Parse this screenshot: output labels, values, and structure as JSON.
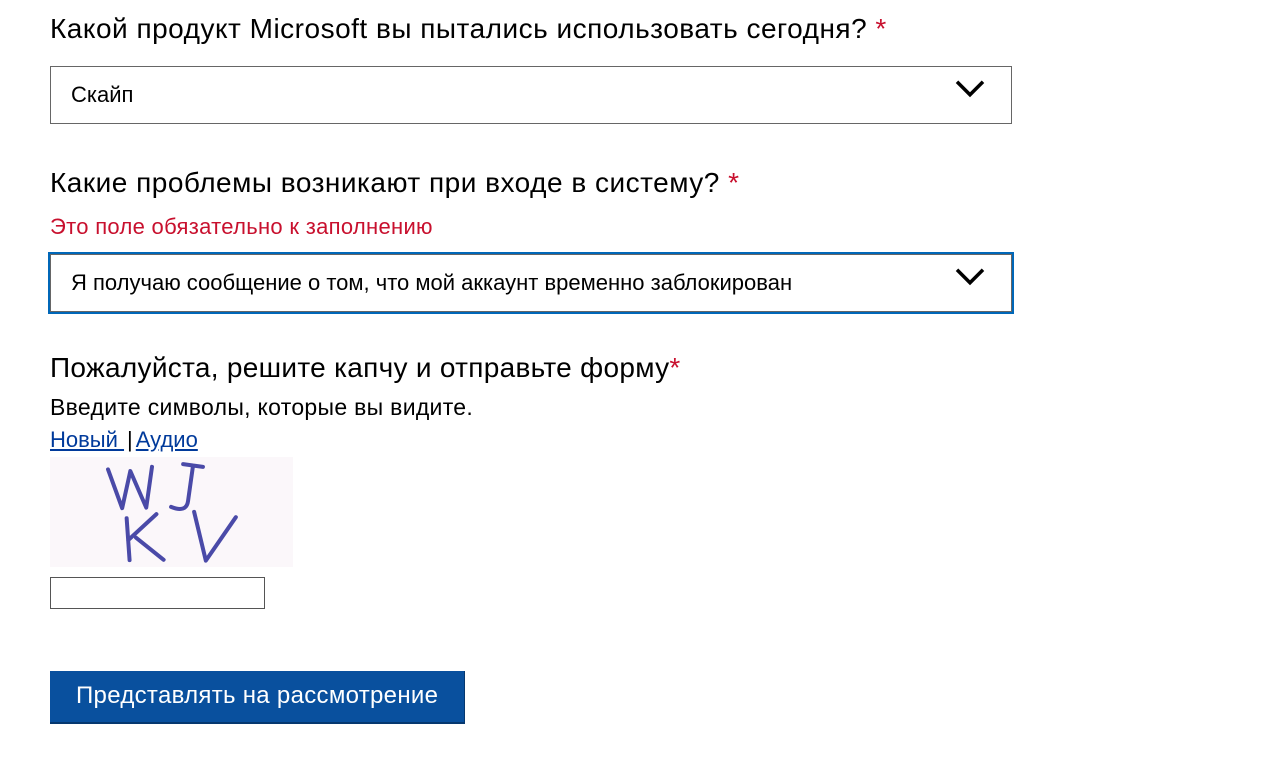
{
  "q1": {
    "label": "Какой продукт Microsoft вы пытались использовать сегодня?",
    "required_mark": "*",
    "value": "Скайп"
  },
  "q2": {
    "label": "Какие проблемы возникают при входе в систему?",
    "required_mark": "*",
    "error": "Это поле обязательно к заполнению",
    "value": "Я получаю сообщение о том, что мой аккаунт временно заблокирован"
  },
  "captcha": {
    "label": "Пожалуйста, решите капчу и отправьте форму",
    "required_mark": "*",
    "sub": "Введите символы, которые вы видите.",
    "link_new": "Новый ",
    "divider": "| ",
    "link_audio": "Аудио",
    "image_chars": "WJ KV",
    "input_value": ""
  },
  "submit": {
    "label": "Представлять на рассмотрение"
  }
}
